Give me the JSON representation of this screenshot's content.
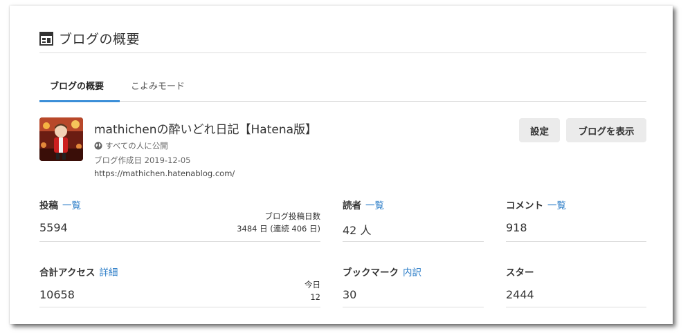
{
  "header": {
    "title": "ブログの概要"
  },
  "tabs": [
    {
      "label": "ブログの概要",
      "active": true
    },
    {
      "label": "こよみモード",
      "active": false
    }
  ],
  "blog": {
    "title": "mathichenの酔いどれ日記【Hatena版】",
    "visibility": "すべての人に公開",
    "created": "ブログ作成日 2019-12-05",
    "url": "https://mathichen.hatenablog.com/"
  },
  "buttons": {
    "settings": "設定",
    "view_blog": "ブログを表示"
  },
  "stats": {
    "posts": {
      "label": "投稿",
      "link": "一覧",
      "value": "5594",
      "side_label": "ブログ投稿日数",
      "side_value": "3484 日 (連続 406 日)"
    },
    "readers": {
      "label": "読者",
      "link": "一覧",
      "value": "42 人"
    },
    "comments": {
      "label": "コメント",
      "link": "一覧",
      "value": "918"
    },
    "access": {
      "label": "合計アクセス",
      "link": "詳細",
      "value": "10658",
      "side_label": "今日",
      "side_value": "12"
    },
    "bookmarks": {
      "label": "ブックマーク",
      "link": "内訳",
      "value": "30"
    },
    "stars": {
      "label": "スター",
      "value": "2444"
    }
  },
  "colors": {
    "accent": "#3b8ed8",
    "link": "#2a7cc7",
    "button_bg": "#ebebeb"
  },
  "icons": [
    "dashboard-icon",
    "globe-icon"
  ]
}
